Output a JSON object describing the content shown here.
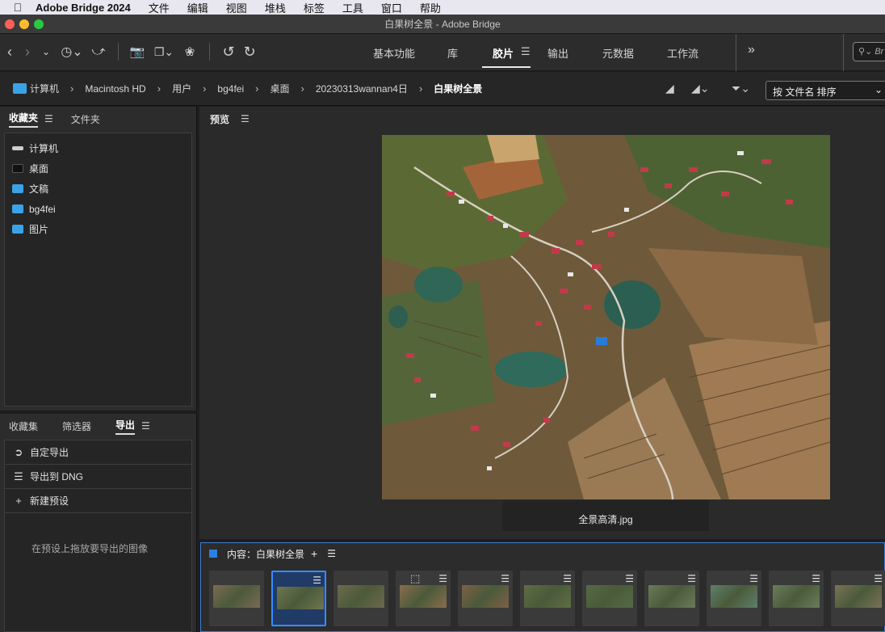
{
  "menubar": {
    "app_name": "Adobe Bridge 2024",
    "items": [
      "文件",
      "编辑",
      "视图",
      "堆栈",
      "标签",
      "工具",
      "窗口",
      "帮助"
    ]
  },
  "window": {
    "title": "白果树全景 - Adobe Bridge"
  },
  "toolbar": {
    "workspaces": [
      {
        "label": "基本功能",
        "active": false
      },
      {
        "label": "库",
        "active": false
      },
      {
        "label": "胶片",
        "active": true
      },
      {
        "label": "输出",
        "active": false
      },
      {
        "label": "元数据",
        "active": false
      },
      {
        "label": "工作流",
        "active": false
      }
    ],
    "overflow_label": "»",
    "search_placeholder": "Br"
  },
  "pathbar": {
    "crumbs": [
      "计算机",
      "Macintosh HD",
      "用户",
      "bg4fei",
      "桌面",
      "20230313wannan4日",
      "白果树全景"
    ],
    "sort_label": "按 文件名 排序"
  },
  "favorites_panel": {
    "tabs": [
      {
        "label": "收藏夹",
        "active": true
      },
      {
        "label": "文件夹",
        "active": false
      }
    ],
    "items": [
      {
        "label": "计算机",
        "icon": "computer-icon"
      },
      {
        "label": "桌面",
        "icon": "desktop-icon"
      },
      {
        "label": "文稿",
        "icon": "documents-folder-icon"
      },
      {
        "label": "bg4fei",
        "icon": "home-folder-icon"
      },
      {
        "label": "图片",
        "icon": "pictures-folder-icon"
      }
    ]
  },
  "export_panel": {
    "tabs": [
      {
        "label": "收藏集",
        "active": false
      },
      {
        "label": "筛选器",
        "active": false
      },
      {
        "label": "导出",
        "active": true
      }
    ],
    "items": [
      {
        "label": "自定导出",
        "icon": "export-icon"
      },
      {
        "label": "导出到 DNG",
        "icon": "list-icon"
      },
      {
        "label": "新建预设",
        "icon": "plus-icon"
      }
    ],
    "drop_hint": "在预设上拖放要导出的图像"
  },
  "preview_panel": {
    "title": "预览",
    "filename": "全景高清.jpg"
  },
  "content_panel": {
    "title": "内容：白果树全景",
    "add_label": "+",
    "thumbnails": [
      {
        "selected": false,
        "adjusted": false,
        "cropped": false,
        "color": "#7a6a55"
      },
      {
        "selected": true,
        "adjusted": true,
        "cropped": false,
        "color": "#6f7550"
      },
      {
        "selected": false,
        "adjusted": false,
        "cropped": false,
        "color": "#6d6a4c"
      },
      {
        "selected": false,
        "adjusted": true,
        "cropped": true,
        "color": "#8a6d4e"
      },
      {
        "selected": false,
        "adjusted": true,
        "cropped": false,
        "color": "#7d6047"
      },
      {
        "selected": false,
        "adjusted": true,
        "cropped": false,
        "color": "#5f6d44"
      },
      {
        "selected": false,
        "adjusted": true,
        "cropped": false,
        "color": "#566a45"
      },
      {
        "selected": false,
        "adjusted": true,
        "cropped": false,
        "color": "#6c7a5a"
      },
      {
        "selected": false,
        "adjusted": true,
        "cropped": false,
        "color": "#5f7f6a"
      },
      {
        "selected": false,
        "adjusted": true,
        "cropped": false,
        "color": "#6a7d5c"
      },
      {
        "selected": false,
        "adjusted": true,
        "cropped": false,
        "color": "#7a7258"
      }
    ]
  },
  "colors": {
    "accent": "#3a8cff",
    "folder": "#3aa3e8",
    "panel_bg": "#2c2c2c"
  }
}
